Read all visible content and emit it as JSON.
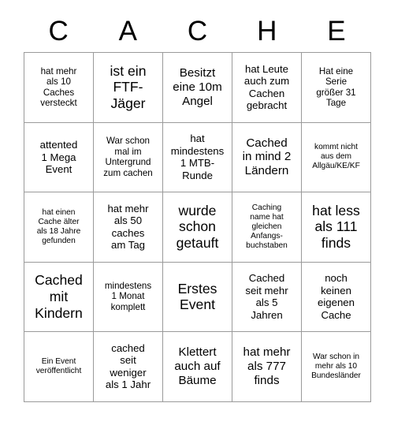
{
  "card": {
    "title_letters": [
      "C",
      "A",
      "C",
      "H",
      "E"
    ],
    "grid_size": "5x5",
    "line_color": "#9a9a9a",
    "text_color": "#000000",
    "background_color": "#ffffff",
    "rows": [
      [
        {
          "text": "hat mehr\nals 10\nCaches\nversteckt",
          "size": "fs-s"
        },
        {
          "text": "ist ein\nFTF-\nJäger",
          "size": "fs-xl"
        },
        {
          "text": "Besitzt\neine 10m\nAngel",
          "size": "fs-l"
        },
        {
          "text": "hat Leute\nauch zum\nCachen\ngebracht",
          "size": "fs-m"
        },
        {
          "text": "Hat eine\nSerie\ngrößer 31\nTage",
          "size": "fs-s"
        }
      ],
      [
        {
          "text": "attented\n1 Mega\nEvent",
          "size": "fs-m"
        },
        {
          "text": "War schon\nmal im\nUntergrund\nzum cachen",
          "size": "fs-s"
        },
        {
          "text": "hat\nmindestens\n1 MTB-\nRunde",
          "size": "fs-m"
        },
        {
          "text": "Cached\nin mind 2\nLändern",
          "size": "fs-l"
        },
        {
          "text": "kommt nicht\naus dem\nAllgäu/KE/KF",
          "size": "fs-xs"
        }
      ],
      [
        {
          "text": "hat einen\nCache älter\nals 18 Jahre\ngefunden",
          "size": "fs-xs"
        },
        {
          "text": "hat mehr\nals 50\ncaches\nam Tag",
          "size": "fs-m"
        },
        {
          "text": "wurde\nschon\ngetauft",
          "size": "fs-xl"
        },
        {
          "text": "Caching\nname hat\ngleichen\nAnfangs-\nbuchstaben",
          "size": "fs-xs"
        },
        {
          "text": "hat less\nals 111\nfinds",
          "size": "fs-xl"
        }
      ],
      [
        {
          "text": "Cached\nmit\nKindern",
          "size": "fs-xl"
        },
        {
          "text": "mindestens\n1 Monat\nkomplett",
          "size": "fs-s"
        },
        {
          "text": "Erstes\nEvent",
          "size": "fs-xl"
        },
        {
          "text": "Cached\nseit mehr\nals 5\nJahren",
          "size": "fs-m"
        },
        {
          "text": "noch\nkeinen\neigenen\nCache",
          "size": "fs-m"
        }
      ],
      [
        {
          "text": "Ein Event\nveröffentlicht",
          "size": "fs-xs"
        },
        {
          "text": "cached\nseit\nweniger\nals 1 Jahr",
          "size": "fs-m"
        },
        {
          "text": "Klettert\nauch auf\nBäume",
          "size": "fs-l"
        },
        {
          "text": "hat mehr\nals 777\nfinds",
          "size": "fs-l"
        },
        {
          "text": "War schon in\nmehr als 10\nBundesländer",
          "size": "fs-xs"
        }
      ]
    ]
  }
}
